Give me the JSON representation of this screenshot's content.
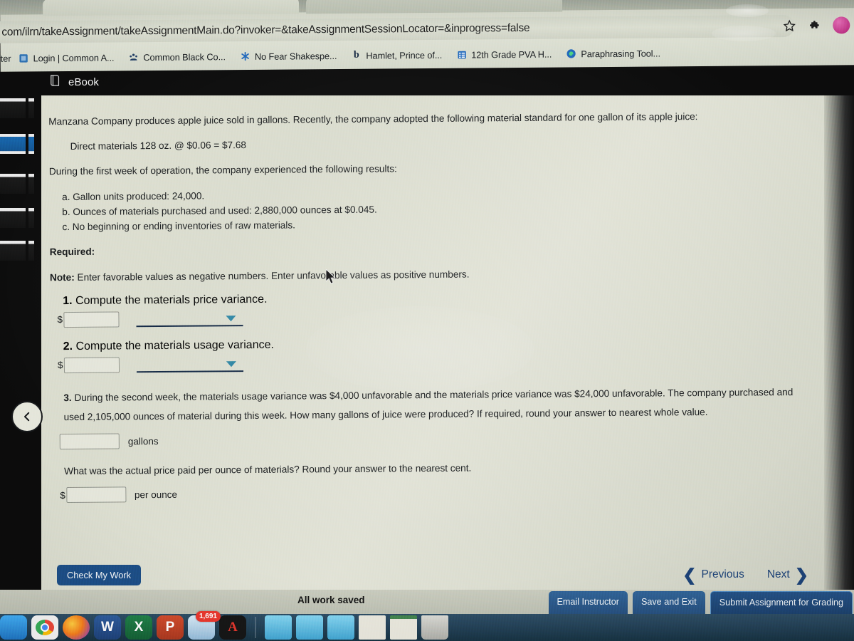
{
  "browser": {
    "url": "com/ilrn/takeAssignment/takeAssignmentMain.do?invoker=&takeAssignmentSessionLocator=&inprogress=false",
    "bookmark_cut_label": "ter",
    "bookmarks": [
      {
        "label": "Login | Common A...",
        "icon": "blue-square-favicon"
      },
      {
        "label": "Common Black Co...",
        "icon": "people-favicon"
      },
      {
        "label": "No Fear Shakespe...",
        "icon": "asterisk-favicon"
      },
      {
        "label": "Hamlet, Prince of...",
        "icon": "letter-b-favicon"
      },
      {
        "label": "12th Grade PVA H...",
        "icon": "list-favicon"
      },
      {
        "label": "Paraphrasing Tool...",
        "icon": "circle-q-favicon"
      }
    ],
    "star_icon": "bookmark-star-icon",
    "extensions_icon": "puzzle-piece-icon",
    "profile_icon": "profile-avatar-icon"
  },
  "app": {
    "ebook_label": "eBook",
    "ebook_icon": "book-icon",
    "back_icon": "chevron-left-icon"
  },
  "problem": {
    "intro": "Manzana Company produces apple juice sold in gallons. Recently, the company adopted the following material standard for one gallon of its apple juice:",
    "standard": "Direct materials 128 oz. @ $0.06 = $7.68",
    "results_intro": "During the first week of operation, the company experienced the following results:",
    "results": [
      "a. Gallon units produced: 24,000.",
      "b. Ounces of materials purchased and used: 2,880,000 ounces at $0.045.",
      "c. No beginning or ending inventories of raw materials."
    ],
    "required_label": "Required:",
    "note_label": "Note:",
    "note_text": " Enter favorable values as negative numbers. Enter unfavorable values as positive numbers.",
    "questions": [
      {
        "num": "1.",
        "text": "Compute the materials price variance.",
        "dollar_prefix": "$",
        "answer_value": "",
        "select_value": ""
      },
      {
        "num": "2.",
        "text": "Compute the materials usage variance.",
        "dollar_prefix": "$",
        "answer_value": "",
        "select_value": ""
      }
    ],
    "q3": {
      "num": "3.",
      "text": "During the second week, the materials usage variance was $4,000 unfavorable and the materials price variance was $24,000 unfavorable. The company purchased and used 2,105,000 ounces of material during this week. How many gallons of juice were produced? If required, round your answer to nearest whole value.",
      "gallons_value": "",
      "gallons_unit": "gallons",
      "followup_text": "What was the actual price paid per ounce of materials? Round your answer to the nearest cent.",
      "price_prefix": "$",
      "price_value": "",
      "price_unit": "per ounce"
    }
  },
  "actions": {
    "check_my_work": "Check My Work",
    "previous": "Previous",
    "next": "Next",
    "prev_icon": "chevron-left-icon",
    "next_icon": "chevron-right-icon"
  },
  "footer": {
    "saved_status": "All work saved",
    "buttons": [
      {
        "label": "Email Instructor",
        "primary": false
      },
      {
        "label": "Save and Exit",
        "primary": false
      },
      {
        "label": "Submit Assignment for Grading",
        "primary": true
      }
    ]
  },
  "dock": {
    "items": [
      {
        "name": "finder",
        "glyph": "",
        "color1": "#3fa9f5",
        "color2": "#1e6fc0",
        "badge": ""
      },
      {
        "name": "chrome",
        "glyph": "",
        "color1": "#f6f6f6",
        "color2": "#dcdcdc",
        "badge": ""
      },
      {
        "name": "firefox",
        "glyph": "",
        "color1": "#f5a623",
        "color2": "#8a3fd1",
        "badge": ""
      },
      {
        "name": "word",
        "glyph": "W",
        "color1": "#2b5797",
        "color2": "#1d3f74",
        "badge": ""
      },
      {
        "name": "excel",
        "glyph": "X",
        "color1": "#1f7a45",
        "color2": "#145c33",
        "badge": ""
      },
      {
        "name": "powerpoint",
        "glyph": "P",
        "color1": "#d0482a",
        "color2": "#a8361e",
        "badge": ""
      },
      {
        "name": "mail",
        "glyph": "",
        "color1": "#cfe3f2",
        "color2": "#8fb8d8",
        "badge": "1,691"
      },
      {
        "name": "acrobat-reader",
        "glyph": "",
        "color1": "#1a1a1a",
        "color2": "#0d0d0d",
        "badge": ""
      }
    ],
    "files": [
      {
        "name": "folder-1",
        "kind": "folder"
      },
      {
        "name": "folder-2",
        "kind": "folder"
      },
      {
        "name": "folder-3",
        "kind": "folder"
      },
      {
        "name": "document-1",
        "kind": "doc"
      },
      {
        "name": "document-2",
        "kind": "doc"
      },
      {
        "name": "trash",
        "kind": "trash"
      }
    ]
  },
  "colors": {
    "accent_blue": "#1b4a80",
    "nav_blue": "#1b3f72",
    "select_arrow": "#2b7f9e",
    "underline": "#155a8a",
    "badge_red": "#e8342b"
  }
}
